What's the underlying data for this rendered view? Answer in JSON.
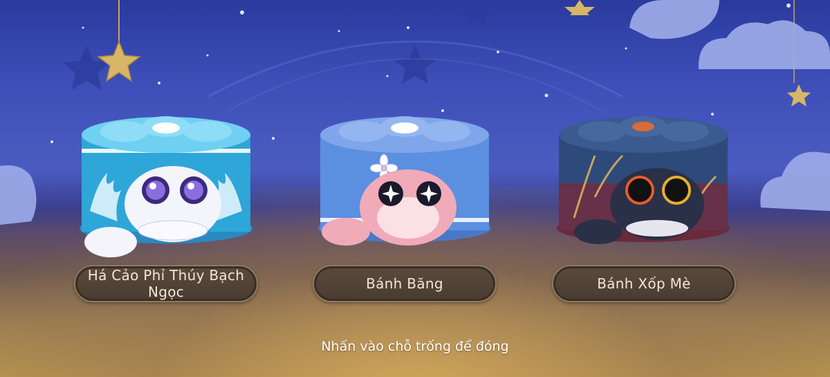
{
  "colors": {
    "sky_top": "#2a3a9e",
    "floor": "#b8954f",
    "label_bg": "#4a3b31",
    "label_border": "#8c7a62",
    "label_text": "#f1e6d2",
    "cake_jade": "#3ab6e0",
    "cake_ice": "#5b8fe0",
    "cake_sesame": "#2e4a7a"
  },
  "items": [
    {
      "name": "Há Cảo Phỉ Thúy Bạch Ngọc",
      "icon": "jade-dumpling-cat-icon"
    },
    {
      "name": "Bánh Băng",
      "icon": "ice-mooncake-cat-icon"
    },
    {
      "name": "Bánh Xốp Mè",
      "icon": "sesame-cake-cat-icon"
    }
  ],
  "hint": "Nhấn vào chỗ trống để đóng"
}
